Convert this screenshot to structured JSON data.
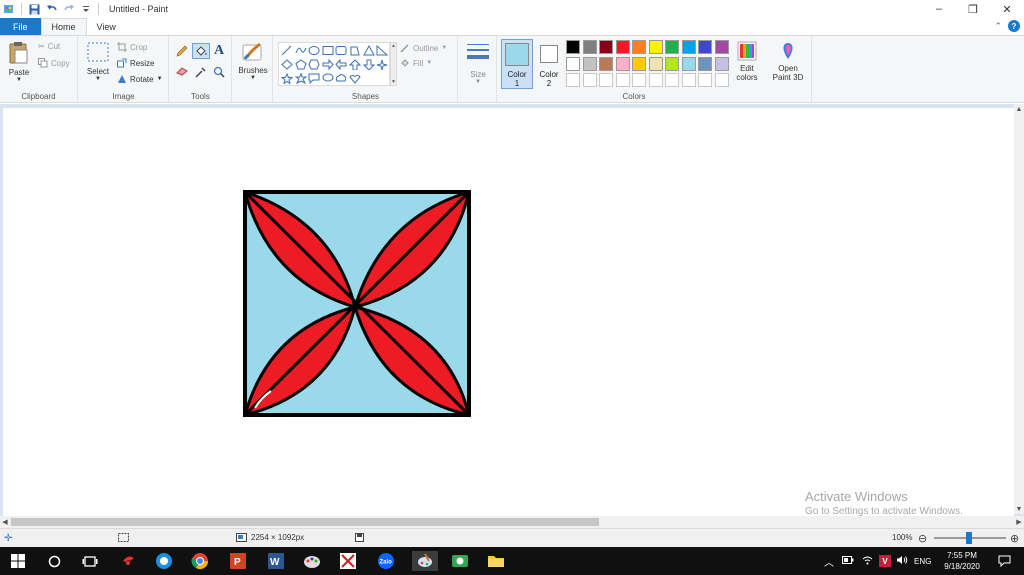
{
  "window": {
    "title": "Untitled - Paint",
    "controls": {
      "minimize": "–",
      "maximize": "❐",
      "close": "✕"
    }
  },
  "tabs": [
    {
      "label": "File"
    },
    {
      "label": "Home"
    },
    {
      "label": "View"
    }
  ],
  "ribbon": {
    "clipboard": {
      "label": "Clipboard",
      "paste": "Paste",
      "cut": "Cut",
      "copy": "Copy"
    },
    "image": {
      "label": "Image",
      "select": "Select",
      "crop": "Crop",
      "resize": "Resize",
      "rotate": "Rotate"
    },
    "tools": {
      "label": "Tools"
    },
    "brushes": {
      "label": "Brushes"
    },
    "shapes": {
      "label": "Shapes",
      "outline": "Outline",
      "fill": "Fill"
    },
    "size": {
      "label": "Size"
    },
    "color1": {
      "label_line1": "Color",
      "label_line2": "1",
      "value": "#99d9ea"
    },
    "color2": {
      "label_line1": "Color",
      "label_line2": "2",
      "value": "#ffffff"
    },
    "colors": {
      "label": "Colors",
      "row1": [
        "#000000",
        "#7f7f7f",
        "#880015",
        "#ed1c24",
        "#ff7f27",
        "#fff200",
        "#22b14c",
        "#00a2e8",
        "#3f48cc",
        "#a349a4"
      ],
      "row2": [
        "#ffffff",
        "#c3c3c3",
        "#b97a57",
        "#ffaec9",
        "#ffc90e",
        "#efe4b0",
        "#b5e61d",
        "#99d9ea",
        "#7092be",
        "#c8bfe7"
      ],
      "row3": [
        "#ffffff",
        "#ffffff",
        "#ffffff",
        "#ffffff",
        "#ffffff",
        "#ffffff",
        "#ffffff",
        "#ffffff",
        "#ffffff",
        "#ffffff"
      ]
    },
    "edit_colors": {
      "line1": "Edit",
      "line2": "colors"
    },
    "paint3d": {
      "line1": "Open",
      "line2": "Paint 3D"
    }
  },
  "drawing": {
    "square_fill": "#99d9ea",
    "petal_fill": "#ed1c24",
    "stroke": "#000000"
  },
  "watermark": {
    "line1": "Activate Windows",
    "line2": "Go to Settings to activate Windows."
  },
  "statusbar": {
    "dimensions": "2254 × 1092px",
    "zoom": "100%"
  },
  "taskbar": {
    "language": "ENG",
    "time": "7:55 PM",
    "date": "9/18/2020"
  }
}
